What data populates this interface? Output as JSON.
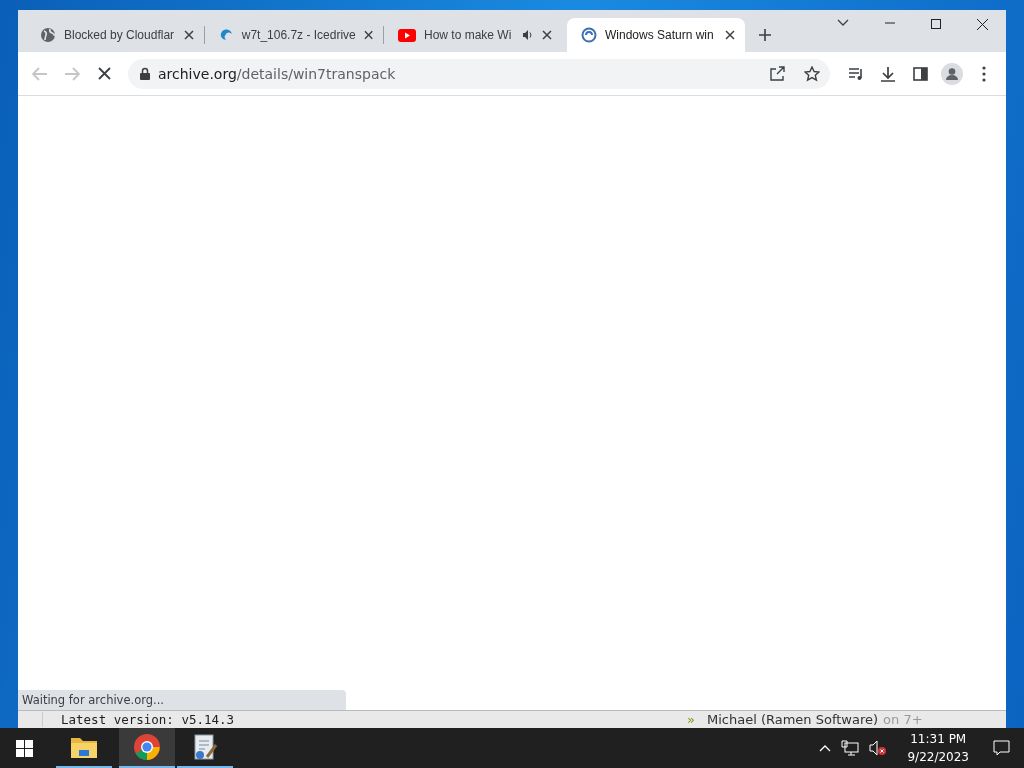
{
  "browser": {
    "tabs": [
      {
        "title": "Blocked by Cloudflar",
        "kind": "globe",
        "audio": false,
        "selected": false
      },
      {
        "title": "w7t_106.7z - Icedrive",
        "kind": "icedrive",
        "audio": false,
        "selected": false
      },
      {
        "title": "How to make Wi",
        "kind": "youtube",
        "audio": true,
        "selected": false
      },
      {
        "title": "Windows Saturn win",
        "kind": "saturn",
        "audio": false,
        "selected": true
      }
    ],
    "address": {
      "host": "archive.org",
      "path": "/details/win7transpack"
    },
    "back_disabled": true,
    "forward_disabled": true,
    "loading": true,
    "status": "Waiting for archive.org..."
  },
  "background_window": {
    "left": "Latest version: v5.14.3",
    "bullet": "»",
    "author": "Michael (Ramen Software)",
    "on": "on 7+"
  },
  "taskbar": {
    "apps": [
      {
        "kind": "explorer",
        "selected": false
      },
      {
        "kind": "chrome",
        "selected": true
      },
      {
        "kind": "tool",
        "selected": false
      }
    ],
    "time": "11:31 PM",
    "date": "9/22/2023"
  }
}
